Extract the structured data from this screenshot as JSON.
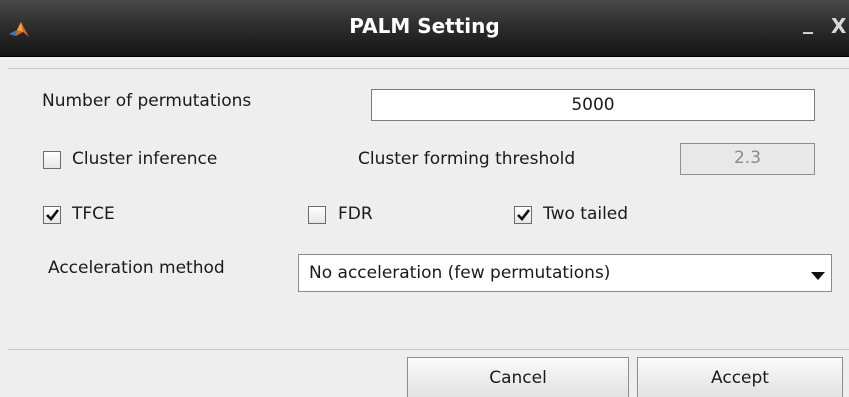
{
  "window": {
    "title": "PALM Setting",
    "minimize_glyph": "_",
    "close_glyph": "X"
  },
  "icons": {
    "app": "matlab-logo-icon",
    "minimize": "minimize-icon",
    "close": "close-icon",
    "checkmark": "checkmark-icon",
    "dropdown": "chevron-down-icon"
  },
  "permutations": {
    "label": "Number of permutations",
    "value": "5000"
  },
  "cluster": {
    "inference_label": "Cluster inference",
    "inference_checked": false,
    "threshold_label": "Cluster forming threshold",
    "threshold_value": "2.3"
  },
  "options": {
    "tfce_label": "TFCE",
    "tfce_checked": true,
    "fdr_label": "FDR",
    "fdr_checked": false,
    "two_tailed_label": "Two tailed",
    "two_tailed_checked": true
  },
  "acceleration": {
    "label": "Acceleration method",
    "selected": "No acceleration (few permutations)"
  },
  "buttons": {
    "cancel": "Cancel",
    "accept": "Accept"
  },
  "colors": {
    "titlebar": "#2e2e2e",
    "background": "#eeeeee"
  }
}
